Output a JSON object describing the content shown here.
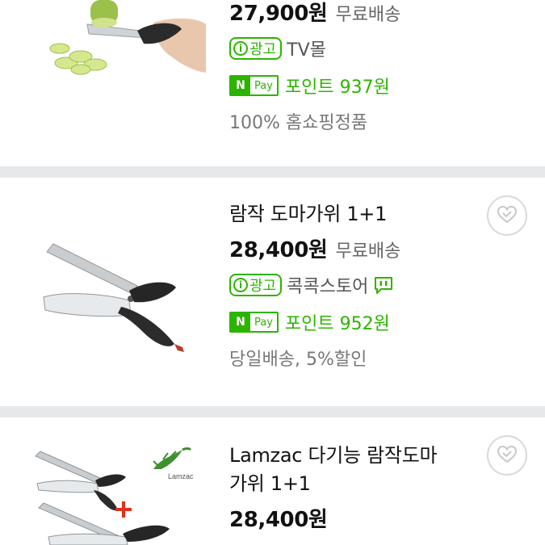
{
  "products": [
    {
      "price": "27,900원",
      "shipping": "무료배송",
      "ad_label": "광고",
      "seller": "TV몰",
      "npay_n": "N",
      "npay_pay": "Pay",
      "points": "포인트 937원",
      "meta": "100% 홈쇼핑정품"
    },
    {
      "title": "람작 도마가위 1+1",
      "price": "28,400원",
      "shipping": "무료배송",
      "ad_label": "광고",
      "seller": "콕콕스토어",
      "npay_n": "N",
      "npay_pay": "Pay",
      "points": "포인트 952원",
      "meta": "당일배송, 5%할인"
    },
    {
      "title_line1": "Lamzac 다기능 람작도마",
      "title_line2": "가위 1+1",
      "price": "28,400원",
      "logo_text": "Lamzac"
    }
  ],
  "colors": {
    "accent": "#2db400",
    "divider": "#e7e8ea"
  }
}
